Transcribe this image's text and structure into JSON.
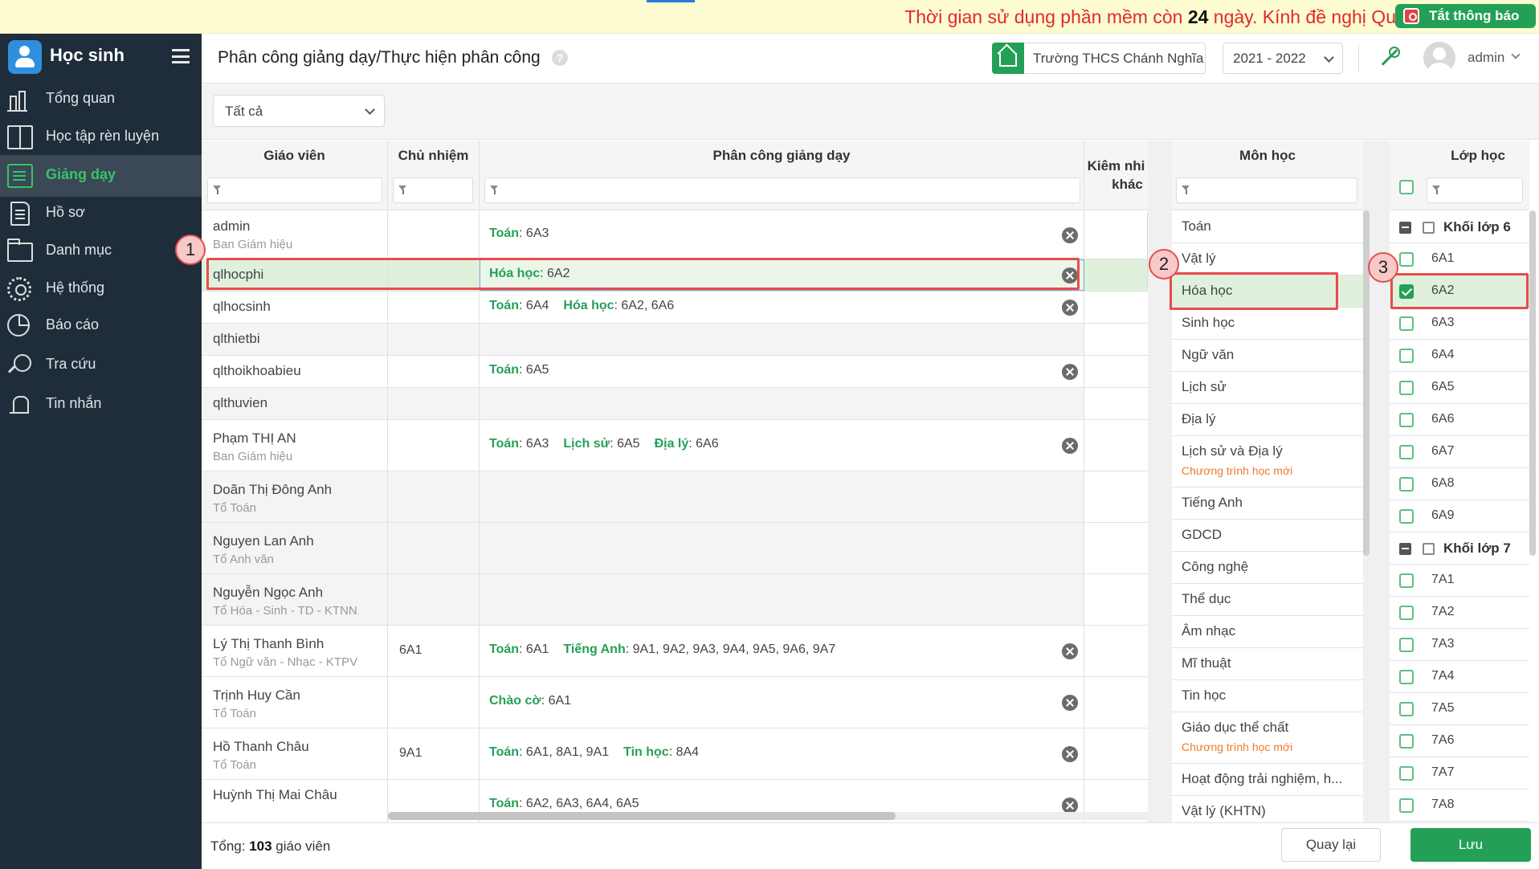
{
  "notice": {
    "prefix": "Thời gian sử dụng phần mềm còn ",
    "days": "24",
    "suffix": " ngày. Kính đề nghị Qu",
    "close_label": "Tắt thông báo"
  },
  "sidebar": {
    "title": "Học sinh",
    "items": [
      {
        "label": "Tổng quan",
        "icon": "chart-bars-icon"
      },
      {
        "label": "Học tập rèn luyện",
        "icon": "book-icon"
      },
      {
        "label": "Giảng dạy",
        "icon": "teaching-board-icon",
        "active": true
      },
      {
        "label": "Hồ sơ",
        "icon": "document-icon"
      },
      {
        "label": "Danh mục",
        "icon": "folder-icon"
      },
      {
        "label": "Hệ thống",
        "icon": "gear-icon"
      },
      {
        "label": "Báo cáo",
        "icon": "pie-chart-icon"
      },
      {
        "label": "Tra cứu",
        "icon": "search-icon"
      },
      {
        "label": "Tin nhắn",
        "icon": "bell-icon"
      }
    ]
  },
  "header": {
    "page_title": "Phân công giảng dạy/Thực hiện phân công",
    "help": "?",
    "school": "Trường THCS Chánh Nghĩa",
    "year": "2021 - 2022",
    "user": "admin"
  },
  "filter": {
    "scope": "Tất cả"
  },
  "columns": {
    "teacher": "Giáo viên",
    "homeroom": "Chủ nhiệm",
    "assignment": "Phân công giảng dạy",
    "other_1": "Kiêm nhi",
    "other_2": "khác",
    "subject": "Môn học",
    "class": "Lớp học"
  },
  "teachers": [
    {
      "name": "admin",
      "dept": "Ban Giám hiệu",
      "homeroom": "",
      "assignments": [
        {
          "subject": "Toán",
          "classes": "6A3"
        }
      ]
    },
    {
      "name": "qlhocphi",
      "dept": "",
      "homeroom": "",
      "assignments": [
        {
          "subject": "Hóa học",
          "classes": "6A2"
        }
      ]
    },
    {
      "name": "qlhocsinh",
      "dept": "",
      "homeroom": "",
      "assignments": [
        {
          "subject": "Toán",
          "classes": "6A4"
        },
        {
          "subject": "Hóa học",
          "classes": "6A2, 6A6"
        }
      ]
    },
    {
      "name": "qlthietbi",
      "dept": "",
      "homeroom": "",
      "assignments": []
    },
    {
      "name": "qlthoikhoabieu",
      "dept": "",
      "homeroom": "",
      "assignments": [
        {
          "subject": "Toán",
          "classes": "6A5"
        }
      ]
    },
    {
      "name": "qlthuvien",
      "dept": "",
      "homeroom": "",
      "assignments": []
    },
    {
      "name": "Phạm THỊ AN",
      "dept": "Ban Giám hiệu",
      "homeroom": "",
      "assignments": [
        {
          "subject": "Toán",
          "classes": "6A3"
        },
        {
          "subject": "Lịch sử",
          "classes": "6A5"
        },
        {
          "subject": "Địa lý",
          "classes": "6A6"
        }
      ]
    },
    {
      "name": "Doãn Thị Đông Anh",
      "dept": "Tổ Toán",
      "homeroom": "",
      "assignments": []
    },
    {
      "name": "Nguyen Lan Anh",
      "dept": "Tổ Anh văn",
      "homeroom": "",
      "assignments": []
    },
    {
      "name": "Nguyễn Ngọc Anh",
      "dept": "Tổ Hóa - Sinh - TD - KTNN",
      "homeroom": "",
      "assignments": []
    },
    {
      "name": "Lý Thị Thanh Bình",
      "dept": "Tổ Ngữ văn - Nhạc - KTPV",
      "homeroom": "6A1",
      "assignments": [
        {
          "subject": "Toán",
          "classes": "6A1"
        },
        {
          "subject": "Tiếng Anh",
          "classes": "9A1, 9A2, 9A3, 9A4, 9A5, 9A6, 9A7"
        }
      ]
    },
    {
      "name": "Trịnh Huy Cần",
      "dept": "Tổ Toán",
      "homeroom": "",
      "assignments": [
        {
          "subject": "Chào cờ",
          "classes": "6A1"
        }
      ]
    },
    {
      "name": "Hồ Thanh Châu",
      "dept": "Tổ Toán",
      "homeroom": "9A1",
      "assignments": [
        {
          "subject": "Toán",
          "classes": "6A1, 8A1, 9A1"
        },
        {
          "subject": "Tin học",
          "classes": "8A4"
        }
      ]
    },
    {
      "name": "Huỳnh Thị Mai Châu",
      "dept": "",
      "homeroom": "",
      "assignments": [
        {
          "subject": "Toán",
          "classes": "6A2, 6A3, 6A4, 6A5"
        }
      ]
    }
  ],
  "subjects": [
    {
      "name": "Toán"
    },
    {
      "name": "Vật lý"
    },
    {
      "name": "Hóa học",
      "selected": true
    },
    {
      "name": "Sinh học"
    },
    {
      "name": "Ngữ văn"
    },
    {
      "name": "Lịch sử"
    },
    {
      "name": "Địa lý"
    },
    {
      "name": "Lịch sử và Địa lý",
      "note": "Chương trình học mới"
    },
    {
      "name": "Tiếng Anh"
    },
    {
      "name": "GDCD"
    },
    {
      "name": "Công nghệ"
    },
    {
      "name": "Thể dục"
    },
    {
      "name": "Âm nhạc"
    },
    {
      "name": "Mĩ thuật"
    },
    {
      "name": "Tin học"
    },
    {
      "name": "Giáo dục thể chất",
      "note": "Chương trình học mới"
    },
    {
      "name": "Hoạt động trải nghiệm, h..."
    },
    {
      "name": "Vật lý (KHTN)"
    }
  ],
  "class_groups": [
    {
      "label": "Khối lớp 6",
      "classes": [
        {
          "name": "6A1",
          "checked": false
        },
        {
          "name": "6A2",
          "checked": true
        },
        {
          "name": "6A3",
          "checked": false
        },
        {
          "name": "6A4",
          "checked": false
        },
        {
          "name": "6A5",
          "checked": false
        },
        {
          "name": "6A6",
          "checked": false
        },
        {
          "name": "6A7",
          "checked": false
        },
        {
          "name": "6A8",
          "checked": false
        },
        {
          "name": "6A9",
          "checked": false
        }
      ]
    },
    {
      "label": "Khối lớp 7",
      "classes": [
        {
          "name": "7A1",
          "checked": false
        },
        {
          "name": "7A2",
          "checked": false
        },
        {
          "name": "7A3",
          "checked": false
        },
        {
          "name": "7A4",
          "checked": false
        },
        {
          "name": "7A5",
          "checked": false
        },
        {
          "name": "7A6",
          "checked": false
        },
        {
          "name": "7A7",
          "checked": false
        },
        {
          "name": "7A8",
          "checked": false
        }
      ]
    }
  ],
  "steps": [
    "1",
    "2",
    "3"
  ],
  "footer": {
    "total_prefix": "Tổng: ",
    "total_count": "103",
    "total_suffix": " giáo viên",
    "back_label": "Quay lại",
    "save_label": "Lưu"
  },
  "colors": {
    "accent": "#24a056",
    "sidebar": "#1f2d3a",
    "warning_text": "#e12a2a",
    "highlight": "#e84c4c"
  }
}
